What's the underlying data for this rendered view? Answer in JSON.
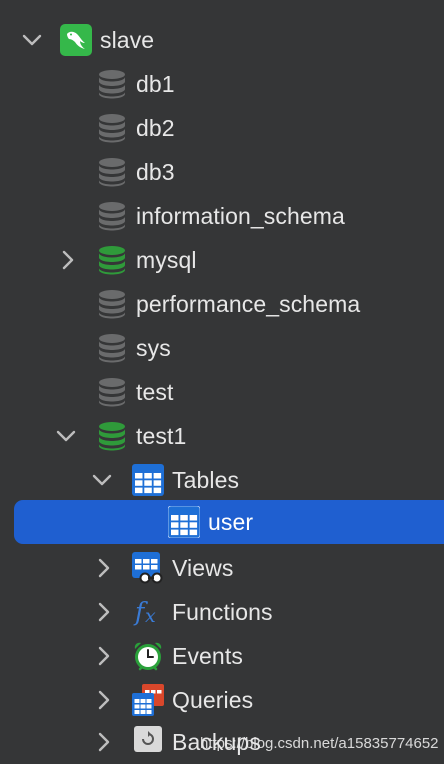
{
  "tree": {
    "server": {
      "name": "slave",
      "icon": "mysql-dolphin-icon",
      "expanded": true
    },
    "databases": [
      {
        "name": "db1",
        "active": false,
        "expandable": false,
        "expanded": false
      },
      {
        "name": "db2",
        "active": false,
        "expandable": false,
        "expanded": false
      },
      {
        "name": "db3",
        "active": false,
        "expandable": false,
        "expanded": false
      },
      {
        "name": "information_schema",
        "active": false,
        "expandable": false,
        "expanded": false
      },
      {
        "name": "mysql",
        "active": true,
        "expandable": true,
        "expanded": false
      },
      {
        "name": "performance_schema",
        "active": false,
        "expandable": false,
        "expanded": false
      },
      {
        "name": "sys",
        "active": false,
        "expandable": false,
        "expanded": false
      },
      {
        "name": "test",
        "active": false,
        "expandable": false,
        "expanded": false
      },
      {
        "name": "test1",
        "active": true,
        "expandable": true,
        "expanded": true
      }
    ],
    "test1_children": [
      {
        "name": "Tables",
        "icon": "table-icon",
        "expanded": true
      },
      {
        "name": "user",
        "icon": "table-icon",
        "selected": true
      },
      {
        "name": "Views",
        "icon": "view-icon",
        "expanded": false
      },
      {
        "name": "Functions",
        "icon": "function-icon",
        "expanded": false
      },
      {
        "name": "Events",
        "icon": "event-clock-icon",
        "expanded": false
      },
      {
        "name": "Queries",
        "icon": "query-icon",
        "expanded": false
      },
      {
        "name": "Backups",
        "icon": "backup-icon",
        "expanded": false
      }
    ]
  },
  "colors": {
    "background": "#353637",
    "selection": "#1f5fd0",
    "active_db": "#2f9a3a",
    "inactive_db": "#6a6b6c",
    "text": "#e7e7e7"
  },
  "watermark": "https://blog.csdn.net/a15835774652"
}
